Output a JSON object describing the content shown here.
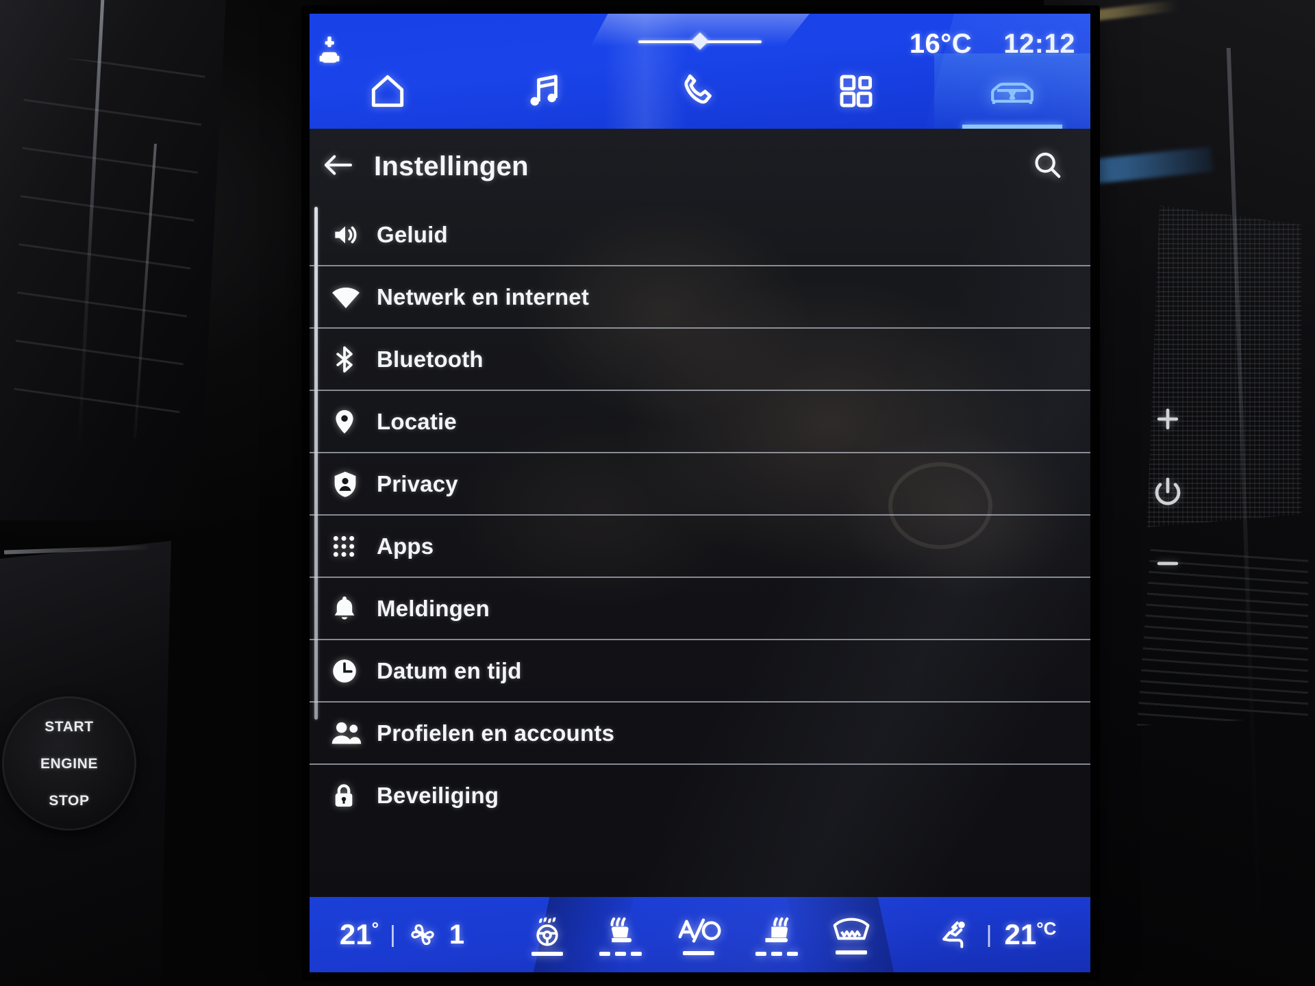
{
  "status_bar": {
    "device_icon": "usb-device-icon",
    "temperature": "16°C",
    "clock": "12:12",
    "drag_handle": "drag-handle"
  },
  "nav_tabs": [
    {
      "id": "home",
      "icon": "home-icon",
      "active": false
    },
    {
      "id": "media",
      "icon": "music-note-icon",
      "active": false
    },
    {
      "id": "phone",
      "icon": "phone-icon",
      "active": false
    },
    {
      "id": "apps",
      "icon": "grid-apps-icon",
      "active": false
    },
    {
      "id": "vehicle",
      "icon": "car-icon",
      "active": true
    }
  ],
  "page": {
    "back_icon": "back-arrow-icon",
    "title": "Instellingen",
    "search_icon": "search-icon"
  },
  "settings_list": [
    {
      "label": "Geluid",
      "icon": "volume-icon"
    },
    {
      "label": "Netwerk en internet",
      "icon": "wifi-icon"
    },
    {
      "label": "Bluetooth",
      "icon": "bluetooth-icon"
    },
    {
      "label": "Locatie",
      "icon": "location-pin-icon"
    },
    {
      "label": "Privacy",
      "icon": "privacy-shield-icon"
    },
    {
      "label": "Apps",
      "icon": "apps-grid-icon"
    },
    {
      "label": "Meldingen",
      "icon": "bell-icon"
    },
    {
      "label": "Datum en tijd",
      "icon": "clock-icon"
    },
    {
      "label": "Profielen en accounts",
      "icon": "people-icon"
    },
    {
      "label": "Beveiliging",
      "icon": "lock-icon"
    }
  ],
  "climate_bar": {
    "left_temperature": "21",
    "left_degree": "°",
    "separator": "|",
    "fan_icon": "fan-icon",
    "fan_speed": "1",
    "buttons": [
      {
        "id": "steering-wheel-heater",
        "icon": "steering-wheel-heat-icon",
        "active": true
      },
      {
        "id": "seat-heater-left",
        "icon": "seat-heat-icon",
        "active": true
      },
      {
        "id": "ac",
        "icon": "ac-icon",
        "active": true
      },
      {
        "id": "seat-heater-right",
        "icon": "seat-heat-icon",
        "active": true
      },
      {
        "id": "rear-defrost",
        "icon": "rear-defrost-icon",
        "active": true
      }
    ],
    "airflow_icon": "airflow-direction-icon",
    "right_separator": "|",
    "right_temperature": "21",
    "right_degree": "°C"
  },
  "hardware": {
    "volume_up": "+",
    "power_icon": "power-icon",
    "volume_down": "−",
    "start_stop_line1": "START",
    "start_stop_line2": "ENGINE",
    "start_stop_line3": "STOP"
  },
  "colors": {
    "accent_blue": "#1842e8",
    "climate_blue": "#1b3fd8",
    "active_tab": "#8fc6ff",
    "screen_bg": "#17181c",
    "text": "#f3f5f8"
  }
}
